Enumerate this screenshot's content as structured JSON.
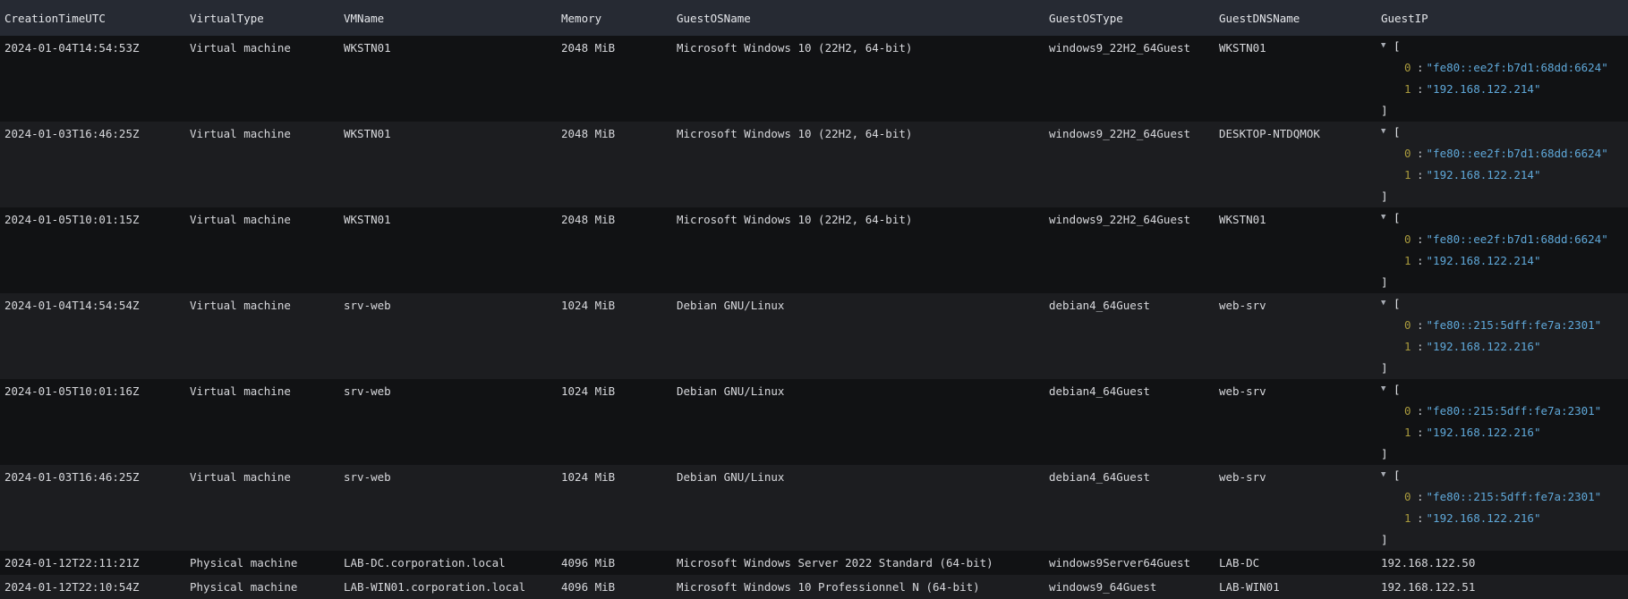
{
  "columns": [
    "CreationTimeUTC",
    "VirtualType",
    "VMName",
    "Memory",
    "GuestOSName",
    "GuestOSType",
    "GuestDNSName",
    "GuestIP"
  ],
  "rows": [
    {
      "time": "2024-01-04T14:54:53Z",
      "vtype": "Virtual machine",
      "vmname": "WKSTN01",
      "memory": "2048 MiB",
      "osname": "Microsoft Windows 10 (22H2, 64-bit)",
      "ostype": "windows9_22H2_64Guest",
      "dns": "WKSTN01",
      "ip": [
        "\"fe80::ee2f:b7d1:68dd:6624\"",
        "\"192.168.122.214\""
      ]
    },
    {
      "time": "2024-01-03T16:46:25Z",
      "vtype": "Virtual machine",
      "vmname": "WKSTN01",
      "memory": "2048 MiB",
      "osname": "Microsoft Windows 10 (22H2, 64-bit)",
      "ostype": "windows9_22H2_64Guest",
      "dns": "DESKTOP-NTDQMOK",
      "ip": [
        "\"fe80::ee2f:b7d1:68dd:6624\"",
        "\"192.168.122.214\""
      ]
    },
    {
      "time": "2024-01-05T10:01:15Z",
      "vtype": "Virtual machine",
      "vmname": "WKSTN01",
      "memory": "2048 MiB",
      "osname": "Microsoft Windows 10 (22H2, 64-bit)",
      "ostype": "windows9_22H2_64Guest",
      "dns": "WKSTN01",
      "ip": [
        "\"fe80::ee2f:b7d1:68dd:6624\"",
        "\"192.168.122.214\""
      ]
    },
    {
      "time": "2024-01-04T14:54:54Z",
      "vtype": "Virtual machine",
      "vmname": "srv-web",
      "memory": "1024 MiB",
      "osname": "Debian GNU/Linux",
      "ostype": "debian4_64Guest",
      "dns": "web-srv",
      "ip": [
        "\"fe80::215:5dff:fe7a:2301\"",
        "\"192.168.122.216\""
      ]
    },
    {
      "time": "2024-01-05T10:01:16Z",
      "vtype": "Virtual machine",
      "vmname": "srv-web",
      "memory": "1024 MiB",
      "osname": "Debian GNU/Linux",
      "ostype": "debian4_64Guest",
      "dns": "web-srv",
      "ip": [
        "\"fe80::215:5dff:fe7a:2301\"",
        "\"192.168.122.216\""
      ]
    },
    {
      "time": "2024-01-03T16:46:25Z",
      "vtype": "Virtual machine",
      "vmname": "srv-web",
      "memory": "1024 MiB",
      "osname": "Debian GNU/Linux",
      "ostype": "debian4_64Guest",
      "dns": "web-srv",
      "ip": [
        "\"fe80::215:5dff:fe7a:2301\"",
        "\"192.168.122.216\""
      ]
    },
    {
      "time": "2024-01-12T22:11:21Z",
      "vtype": "Physical machine",
      "vmname": "LAB-DC.corporation.local",
      "memory": "4096 MiB",
      "osname": "Microsoft Windows Server 2022 Standard (64-bit)",
      "ostype": "windows9Server64Guest",
      "dns": "LAB-DC",
      "ip": "192.168.122.50"
    },
    {
      "time": "2024-01-12T22:10:54Z",
      "vtype": "Physical machine",
      "vmname": "LAB-WIN01.corporation.local",
      "memory": "4096 MiB",
      "osname": "Microsoft Windows 10 Professionnel N (64-bit)",
      "ostype": "windows9_64Guest",
      "dns": "LAB-WIN01",
      "ip": "192.168.122.51"
    }
  ],
  "json_tokens": {
    "open": "[",
    "close": "]",
    "idx0": "0",
    "idx1": "1",
    "colon": ":"
  },
  "colors": {
    "header_bg": "#262a33",
    "row_odd": "#111214",
    "row_even": "#1c1d20",
    "json_string": "#5fa8d9",
    "json_index": "#a99a3d"
  },
  "icons": {
    "expand_toggle": "caret-down-icon"
  }
}
